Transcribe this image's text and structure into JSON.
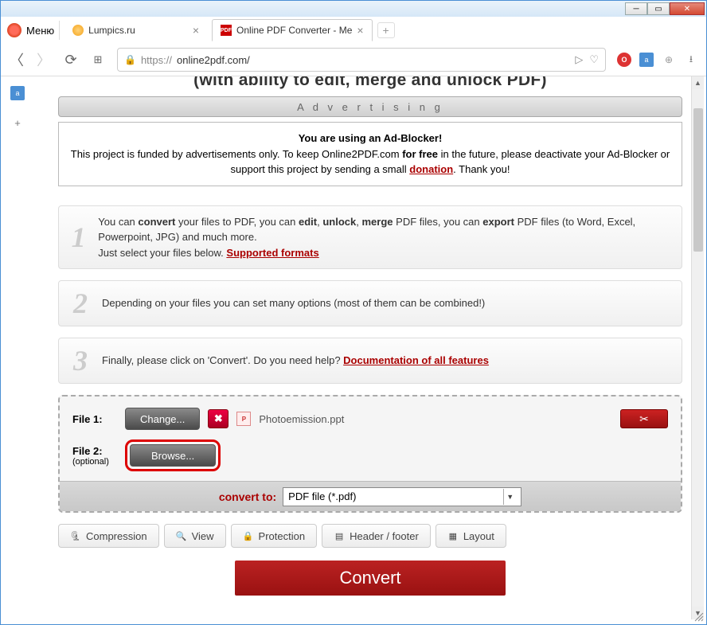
{
  "window": {
    "menu_label": "Меню"
  },
  "tabs": [
    {
      "title": "Lumpics.ru"
    },
    {
      "title": "Online PDF Converter - Me"
    }
  ],
  "address": {
    "scheme": "https://",
    "host": "online2pdf.com/"
  },
  "page": {
    "header_cut": "(with ability to edit, merge and unlock PDF)",
    "advertising_label": "A d v e r t i s i n g",
    "adblock": {
      "title": "You are using an Ad-Blocker!",
      "line_pre": "This project is funded by advertisements only. To keep Online2PDF.com ",
      "bold1": "for free",
      "line_mid": " in the future, please deactivate your Ad-Blocker or support this project by sending a small ",
      "donation": "donation",
      "line_end": ". Thank you!"
    },
    "steps": {
      "s1a": "You can ",
      "s1b": "convert",
      "s1c": " your files to PDF, you can ",
      "s1d": "edit",
      "s1e": ", ",
      "s1f": "unlock",
      "s1g": ", ",
      "s1h": "merge",
      "s1i": " PDF files, you can ",
      "s1j": "export",
      "s1k": " PDF files (to Word, Excel, Powerpoint, JPG) and much more.",
      "s1_select": "Just select your files below. ",
      "s1_link": "Supported formats",
      "s2": "Depending on your files you can set many options (most of them can be combined!)",
      "s3a": "Finally, please click on 'Convert'. Do you need help? ",
      "s3_link": "Documentation of all features"
    },
    "files": {
      "label1": "File 1:",
      "change": "Change...",
      "name1": "Photoemission.ppt",
      "label2": "File 2:",
      "optional": "(optional)",
      "browse": "Browse..."
    },
    "convert_to_label": "convert to:",
    "convert_to_value": "PDF file (*.pdf)",
    "options": {
      "compression": "Compression",
      "view": "View",
      "protection": "Protection",
      "header": "Header / footer",
      "layout": "Layout"
    },
    "convert_button": "Convert"
  }
}
